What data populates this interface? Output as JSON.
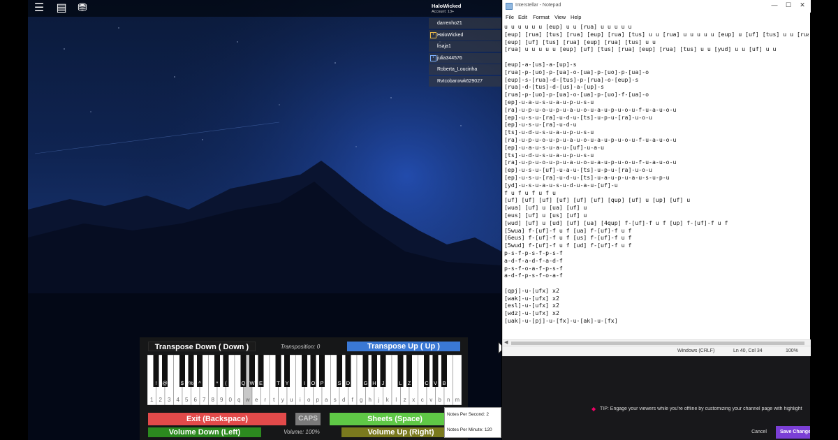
{
  "game": {
    "topbar_icons": [
      "menu-icon",
      "chat-icon",
      "backpack-icon"
    ],
    "player_list": {
      "local_name": "HaloWicked",
      "local_subtitle": "Account: 13+",
      "players": [
        {
          "name": "darrenho21",
          "badge": ""
        },
        {
          "name": "HaloWicked",
          "badge": "gold"
        },
        {
          "name": "lisaja1",
          "badge": ""
        },
        {
          "name": "julia344576",
          "badge": "blue"
        },
        {
          "name": "Roberta_Loucinha",
          "badge": ""
        },
        {
          "name": "Rvtcobanxwk629027",
          "badge": ""
        }
      ]
    },
    "piano": {
      "transpose_down": "Transpose Down ( Down )",
      "transposition": "Transposition: 0",
      "transpose_up": "Transpose Up ( Up )",
      "white_keys": [
        "1",
        "2",
        "3",
        "4",
        "5",
        "6",
        "7",
        "8",
        "9",
        "0",
        "q",
        "w",
        "e",
        "r",
        "t",
        "y",
        "u",
        "i",
        "o",
        "p",
        "a",
        "s",
        "d",
        "f",
        "g",
        "h",
        "j",
        "k",
        "l",
        "z",
        "x",
        "c",
        "v",
        "b",
        "n",
        "m"
      ],
      "black_keys": [
        "!",
        "@",
        "$",
        "%",
        "^",
        "*",
        "(",
        "Q",
        "W",
        "E",
        "T",
        "Y",
        "I",
        "O",
        "P",
        "S",
        "D",
        "G",
        "H",
        "J",
        "L",
        "Z",
        "C",
        "V",
        "B"
      ],
      "pressed_white": "w",
      "exit": "Exit (Backspace)",
      "caps": "CAPS",
      "sheets": "Sheets (Space)",
      "volume_down": "Volume Down (Left)",
      "volume": "Volume: 100%",
      "volume_up": "Volume Up (Right)"
    },
    "notes_panel": {
      "per_second": "Notes Per Second: 2",
      "per_minute": "Notes Per Minute: 120"
    }
  },
  "notepad": {
    "title": "Interstellar - Notepad",
    "controls": [
      "—",
      "☐",
      "✕"
    ],
    "menu": [
      "File",
      "Edit",
      "Format",
      "View",
      "Help"
    ],
    "lines": [
      "u u u u u u [eup] u u [rua] u u u u u",
      "[eup] [rua] [tus] [rua] [eup] [rua] [tus] u u [rua] u u u u u [eup] u [uf] [tus] u u [rua]",
      "[eup] [uf] [tus] [rua] [eup] [rua] [tus] u u",
      "[rua] u u u u u [eup] [uf] [tus] [rua] [eup] [rua] [tus] u u [yud] u u [uf] u u",
      "",
      "[eup]-a-[us]-a-[up]-s",
      "[rua]-p-[uo]-p-[ua]-o-[ua]-p-[uo]-p-[ua]-o",
      "[eup]-s-[rua]-d-[tus]-p-[rua]-o-[eup]-s",
      "[rua]-d-[tus]-d-[us]-a-[up]-s",
      "[rua]-p-[uo]-p-[ua]-o-[ua]-p-[uo]-f-[ua]-o",
      "[ep]-u-a-u-s-u-a-u-p-u-s-u",
      "[ra]-u-p-u-o-u-p-u-a-u-o-u-a-u-p-u-o-u-f-u-a-u-o-u",
      "[ep]-u-s-u-[ra]-u-d-u-[ts]-u-p-u-[ra]-u-o-u",
      "[ep]-u-s-u-[ra]-u-d-u",
      "[ts]-u-d-u-s-u-a-u-p-u-s-u",
      "[ra]-u-p-u-o-u-p-u-a-u-o-u-a-u-p-u-o-u-f-u-a-u-o-u",
      "[ep]-u-a-u-s-u-a-u-[uf]-u-a-u",
      "[ts]-u-d-u-s-u-a-u-p-u-s-u",
      "[ra]-u-p-u-o-u-p-u-a-u-o-u-a-u-p-u-o-u-f-u-a-u-o-u",
      "[ep]-u-s-u-[uf]-u-a-u-[ts]-u-p-u-[ra]-u-o-u",
      "[ep]-u-s-u-[ra]-u-d-u-[ts]-u-a-u-p-u-a-u-s-u-p-u",
      "[yd]-u-s-u-a-u-s-u-d-u-a-u-[uf]-u",
      "f u f u f u f u",
      "[uf] [uf] [uf] [uf] [uf] [uf] [qup] [uf] u [up] [uf] u",
      "[wua] [uf] u [ua] [uf] u",
      "[eus] [uf] u [us] [uf] u",
      "[wud] [uf] u [ud] [uf] [ua] [4qup] f-[uf]-f u f [up] f-[uf]-f u f",
      "[5wua] f-[uf]-f u f [ua] f-[uf]-f u f",
      "[6eus] f-[uf]-f u f [us] f-[uf]-f u f",
      "[5wud] f-[uf]-f u f [ud] f-[uf]-f u f",
      "p-s-f-p-s-f-p-s-f",
      "a-d-f-a-d-f-a-d-f",
      "p-s-f-o-a-f-p-s-f",
      "a-d-f-p-s-f-o-a-f",
      "",
      "[qpj]-u-[ufx] x2",
      "[wak]-u-[ufx] x2",
      "[esl]-u-[ufx] x2",
      "[wdz]-u-[ufx] x2",
      "[uak]-u-[pj]-u-[fx]-u-[ak]-u-[fx]"
    ],
    "status": {
      "line_ending": "Windows (CRLF)",
      "position": "Ln 40, Col 34",
      "zoom": "100%"
    }
  },
  "dashboard": {
    "tip": "TIP: Engage your viewers while you're offline by customizing your channel page with highlight",
    "cancel": "Cancel",
    "save": "Save Changes"
  },
  "colors": {
    "transpose_up": "#3a78d4",
    "exit": "#e24a4a",
    "sheets": "#5fc846",
    "volume_down": "#2c8a1f",
    "volume_up": "#7a7a1e",
    "save": "#7b3fd6"
  }
}
